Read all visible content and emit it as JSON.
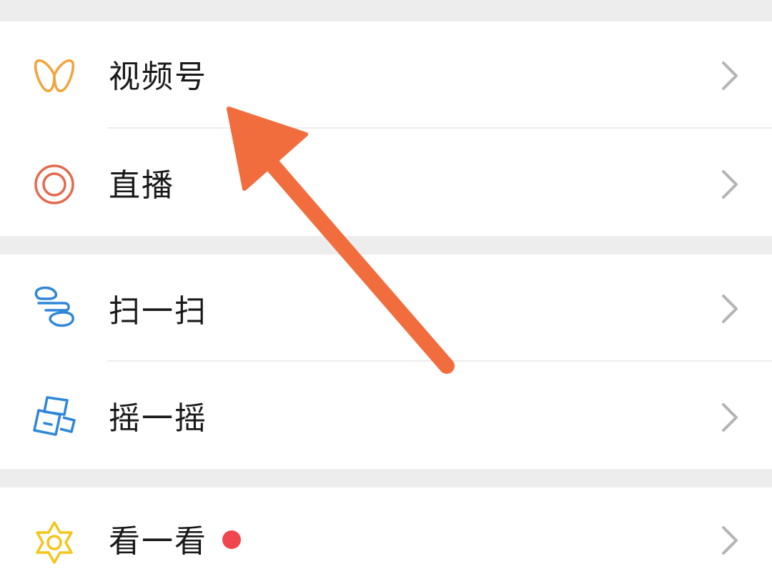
{
  "menu": {
    "items": [
      {
        "label": "视频号",
        "icon": "channels-icon",
        "icon_color": "#f3a33a"
      },
      {
        "label": "直播",
        "icon": "live-icon",
        "icon_color": "#e46a4e"
      },
      {
        "label": "扫一扫",
        "icon": "scan-icon",
        "icon_color": "#2f86d8"
      },
      {
        "label": "摇一摇",
        "icon": "shake-icon",
        "icon_color": "#2f86d8"
      },
      {
        "label": "看一看",
        "icon": "top-stories-icon",
        "icon_color": "#f5c518",
        "badge": true,
        "badge_color": "#f0464f"
      }
    ],
    "chevron_icon": "chevron-right-icon"
  },
  "annotation": {
    "icon": "orange-arrow-annotation",
    "color": "#f26d3d"
  },
  "colors": {
    "background": "#ededed",
    "row_background": "#ffffff",
    "text": "#1a1a1a",
    "chevron": "#b4b4b4"
  }
}
